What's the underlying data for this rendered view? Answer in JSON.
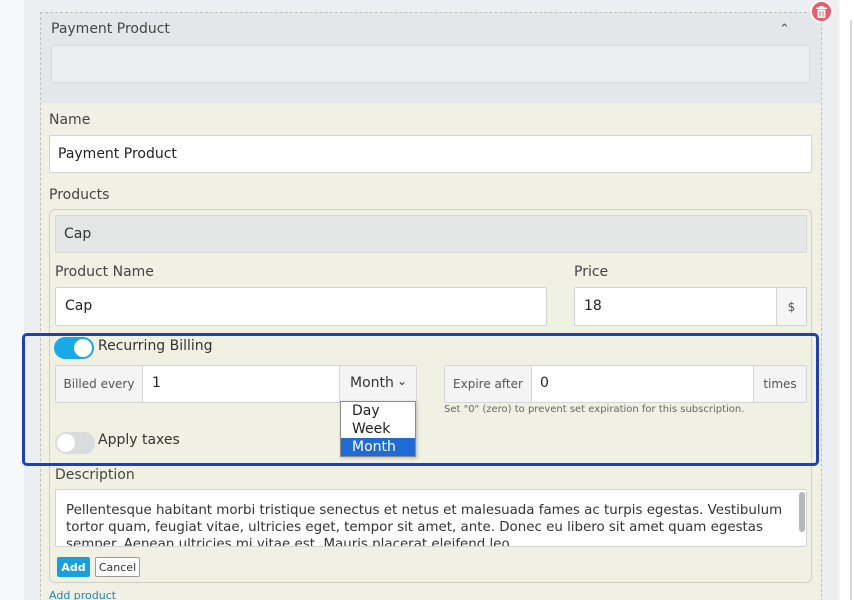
{
  "accordion": {
    "title": "Payment Product",
    "chevron_icon": "chevron-up-icon"
  },
  "delete_icon": "trash-icon",
  "form": {
    "name_label": "Name",
    "name_value": "Payment Product",
    "products_label": "Products",
    "product_header": "Cap",
    "product_name_label": "Product Name",
    "product_name_value": "Cap",
    "price_label": "Price",
    "price_value": "18",
    "price_currency": "$",
    "recurring_billing_label": "Recurring Billing",
    "recurring_billing_on": true,
    "billed_every_label": "Billed every",
    "billed_every_value": "1",
    "period_selected": "Month",
    "period_options": [
      "Day",
      "Week",
      "Month"
    ],
    "expire_after_label": "Expire after",
    "expire_after_value": "0",
    "times_label": "times",
    "expire_help": "Set \"0\" (zero) to prevent set expiration for this subscription.",
    "apply_taxes_label": "Apply taxes",
    "apply_taxes_on": false,
    "description_label": "Description",
    "description_text": "Pellentesque habitant morbi tristique senectus et netus et malesuada fames ac turpis egestas. Vestibulum tortor quam, feugiat vitae, ultricies eget, tempor sit amet, ante. Donec eu libero sit amet quam egestas semper. Aenean ultricies mi vitae est. Mauris placerat eleifend leo."
  },
  "buttons": {
    "add": "Add",
    "cancel": "Cancel",
    "add_product": "Add product"
  },
  "colors": {
    "toggle_on": "#17a9e8",
    "highlight": "#1a3fbf",
    "delete": "#f05a66",
    "dropdown_selected": "#1e6bd6"
  }
}
